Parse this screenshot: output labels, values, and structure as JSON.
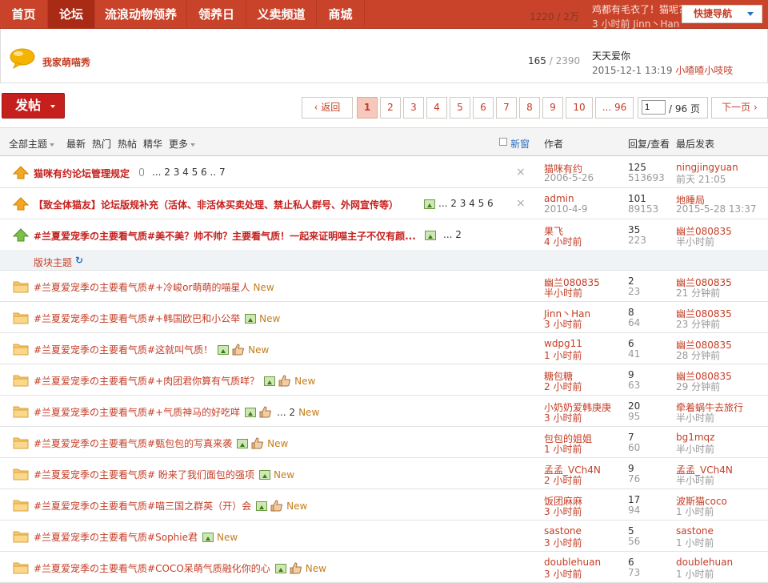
{
  "nav": {
    "items": [
      "首页",
      "论坛",
      "流浪动物领养",
      "领养日",
      "义卖频道",
      "商城"
    ],
    "active": "论坛",
    "quick_nav": "快捷导航",
    "ghost_count": "1220 / 2万",
    "ghost_title": "鸡都有毛衣了！猫呢？",
    "ghost_time": "3 小时前  Jinn丶Han"
  },
  "subforum": {
    "name": "我家萌喵秀",
    "topics": "165",
    "posts": "2390",
    "last_title": "天天爱你",
    "last_time": "2015-12-1 13:19",
    "last_user": "小喳喳小吱吱"
  },
  "toolbar": {
    "post_label": "发帖",
    "prev_label": "返回",
    "pages": [
      "1",
      "2",
      "3",
      "4",
      "5",
      "6",
      "7",
      "8",
      "9",
      "10",
      "... 96"
    ],
    "current_page": "1",
    "page_input": "1",
    "total_pages": "/ 96 页",
    "next_label": "下一页"
  },
  "header": {
    "all_topics": "全部主题",
    "filters": [
      "最新",
      "热门",
      "热帖",
      "精华",
      "更多"
    ],
    "new_window": "新窗",
    "author": "作者",
    "reply_view": "回复/查看",
    "last_post": "最后发表"
  },
  "section_label": "版块主题",
  "sticky": [
    {
      "title": "猫咪有约论坛管理规定",
      "pages": "... 2 3 4 5 6 .. 7",
      "clip": true,
      "img": false,
      "author": "猫咪有约",
      "date": "2006-5-26",
      "replies": "125",
      "views": "513693",
      "last_user": "ningjingyuan",
      "last_time": "前天 21:05"
    },
    {
      "title": "【致全体猫友】论坛版规补充（活体、非活体买卖处理、禁止私人群号、外网宣传等）",
      "pages": "... 2 3 4 5 6",
      "clip": false,
      "img": true,
      "author": "admin",
      "date": "2010-4-9",
      "replies": "101",
      "views": "89153",
      "last_user": "地睡局",
      "last_time": "2015-5-28 13:37"
    },
    {
      "title": "#兰夏爱宠季の主要看气质#美不美？帅不帅？主要看气质！一起来证明喵主子不仅有颜...",
      "pages": "... 2",
      "clip": false,
      "img": true,
      "author": "果飞",
      "date": "4 小时前",
      "replies": "35",
      "views": "223",
      "last_user": "幽兰080835",
      "last_time": "半小时前"
    }
  ],
  "threads": [
    {
      "title": "#兰夏爱宠季の主要看气质#+冷峻or萌萌的喵星人",
      "img": false,
      "thumb": false,
      "pages": "",
      "author": "幽兰080835",
      "date": "半小时前",
      "replies": "2",
      "views": "23",
      "last_user": "幽兰080835",
      "last_time": "21 分钟前"
    },
    {
      "title": "#兰夏爱宠季の主要看气质#+韩国欧巴和小公举",
      "img": true,
      "thumb": false,
      "pages": "",
      "author": "Jinn丶Han",
      "date": "3 小时前",
      "replies": "8",
      "views": "64",
      "last_user": "幽兰080835",
      "last_time": "23 分钟前"
    },
    {
      "title": "#兰夏爱宠季の主要看气质#这就叫气质！",
      "img": true,
      "thumb": true,
      "pages": "",
      "author": "wdpg11",
      "date": "1 小时前",
      "replies": "6",
      "views": "41",
      "last_user": "幽兰080835",
      "last_time": "28 分钟前"
    },
    {
      "title": "#兰夏爱宠季の主要看气质#+肉团君你算有气质咩？",
      "img": true,
      "thumb": true,
      "pages": "",
      "author": "糖包糖",
      "date": "2 小时前",
      "replies": "9",
      "views": "63",
      "last_user": "幽兰080835",
      "last_time": "29 分钟前"
    },
    {
      "title": "#兰夏爱宠季の主要看气质#+气质神马的好吃咩",
      "img": true,
      "thumb": true,
      "pages": "... 2",
      "author": "小奶奶爱韩庚庚",
      "date": "3 小时前",
      "replies": "20",
      "views": "95",
      "last_user": "牵着蜗牛去旅行",
      "last_time": "半小时前"
    },
    {
      "title": "#兰夏爱宠季の主要看气质#甄包包的写真来袭",
      "img": true,
      "thumb": true,
      "pages": "",
      "author": "包包的姐姐",
      "date": "1 小时前",
      "replies": "7",
      "views": "60",
      "last_user": "bg1mqz",
      "last_time": "半小时前"
    },
    {
      "title": "#兰夏爱宠季の主要看气质# 盼来了我们面包的强项",
      "img": true,
      "thumb": false,
      "pages": "",
      "author": "孟孟_VCh4N",
      "date": "2 小时前",
      "replies": "9",
      "views": "76",
      "last_user": "孟孟_VCh4N",
      "last_time": "半小时前"
    },
    {
      "title": "#兰夏爱宠季の主要看气质#喵三国之群英（开）会",
      "img": true,
      "thumb": true,
      "pages": "",
      "author": "饭团麻麻",
      "date": "3 小时前",
      "replies": "17",
      "views": "94",
      "last_user": "波斯猫coco",
      "last_time": "1 小时前"
    },
    {
      "title": "#兰夏爱宠季の主要看气质#Sophie君",
      "img": true,
      "thumb": false,
      "pages": "",
      "author": "sastone",
      "date": "3 小时前",
      "replies": "5",
      "views": "56",
      "last_user": "sastone",
      "last_time": "1 小时前"
    },
    {
      "title": "#兰夏爱宠季の主要看气质#COCO呆萌气质融化你的心",
      "img": true,
      "thumb": true,
      "pages": "",
      "author": "doublehuan",
      "date": "3 小时前",
      "replies": "6",
      "views": "73",
      "last_user": "doublehuan",
      "last_time": "1 小时前"
    }
  ],
  "new_tag": "New",
  "colors": {
    "brand": "#c9432a",
    "link": "#c43d25",
    "post_button": "#c5201d"
  }
}
